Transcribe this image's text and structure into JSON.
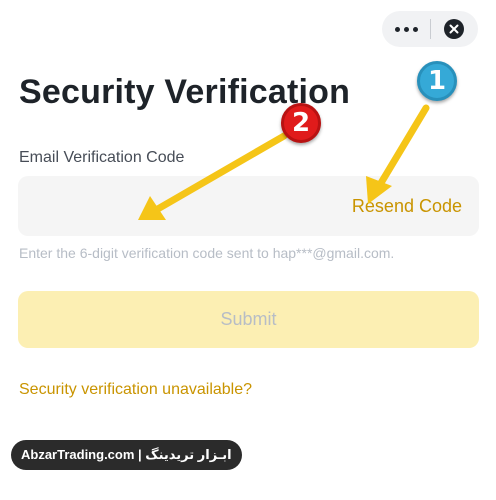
{
  "header": {
    "more_icon": "more-dots-icon",
    "close_icon": "close-icon"
  },
  "page": {
    "title": "Security Verification"
  },
  "form": {
    "field_label": "Email Verification Code",
    "code_value": "",
    "code_placeholder": "",
    "resend_label": "Resend Code",
    "hint": "Enter the 6-digit verification code sent to hap***@gmail.com.",
    "submit_label": "Submit",
    "unavailable_link": "Security verification unavailable?"
  },
  "annotations": {
    "marker_1": "1",
    "marker_2": "2",
    "arrow_color": "#f5c518"
  },
  "watermark": {
    "text": "AbzarTrading.com | ابـزار تریدینگ"
  },
  "colors": {
    "accent": "#c99400",
    "submit_disabled_bg": "#fcefb3",
    "field_bg": "#f5f5f5",
    "text_primary": "#1e2329",
    "text_muted": "#b7bdc6"
  }
}
